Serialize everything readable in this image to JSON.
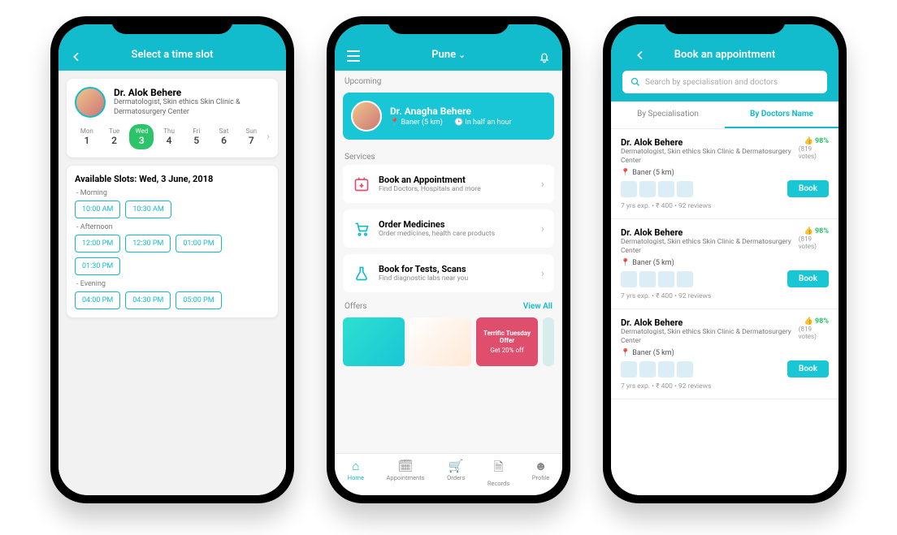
{
  "screen1": {
    "title": "Select a time slot",
    "doctor": {
      "name": "Dr. Alok Behere",
      "sub": "Dermatologist, Skin ethics Skin Clinic & Dermatosurgery Center"
    },
    "days": [
      {
        "lbl": "Mon",
        "num": "1"
      },
      {
        "lbl": "Tue",
        "num": "2"
      },
      {
        "lbl": "Wed",
        "num": "3"
      },
      {
        "lbl": "Thu",
        "num": "4"
      },
      {
        "lbl": "Fri",
        "num": "5"
      },
      {
        "lbl": "Sat",
        "num": "6"
      },
      {
        "lbl": "Sun",
        "num": "7"
      }
    ],
    "available_label": "Available Slots: Wed, 3 June, 2018",
    "morning_label": "- Morning",
    "afternoon_label": "- Afternoon",
    "evening_label": "- Evening",
    "morning": [
      "10:00 AM",
      "10:30 AM"
    ],
    "afternoon": [
      "12:00 PM",
      "12:30 PM",
      "01:00 PM",
      "01:30 PM"
    ],
    "evening": [
      "04:00 PM",
      "04:30 PM",
      "05:00 PM"
    ]
  },
  "screen2": {
    "location": "Pune",
    "upcoming_label": "Upcoming",
    "upcoming": {
      "name": "Dr. Anagha Behere",
      "loc": "Baner (5 km)",
      "eta": "In half an hour"
    },
    "services_label": "Services",
    "services": [
      {
        "t": "Book an Appointment",
        "s": "Find Doctors, Hospitals and more"
      },
      {
        "t": "Order Medicines",
        "s": "Order medicines, health care products"
      },
      {
        "t": "Book for Tests, Scans",
        "s": "Find diagnostic labs near you"
      }
    ],
    "offers_label": "Offers",
    "view_all": "View All",
    "offer2_title": "Terrific Tuesday Offer",
    "offer2_sub": "Get 20% off",
    "tabs": [
      "Home",
      "Appointments",
      "Orders",
      "Records",
      "Profile"
    ]
  },
  "screen3": {
    "title": "Book an appointment",
    "search_placeholder": "Search by specialisation and doctors",
    "tab1": "By Specialisation",
    "tab2": "By Doctors Name",
    "doctor": {
      "name": "Dr. Alok Behere",
      "spec": "Dermatologist, Skin ethics Skin Clinic & Dermatosurgery Center",
      "loc": "Baner (5 km)",
      "rating": "98%",
      "votes": "(819 votes)",
      "meta": "7 yrs exp.  •  ₹ 400  •  92 reviews",
      "book": "Book"
    }
  }
}
